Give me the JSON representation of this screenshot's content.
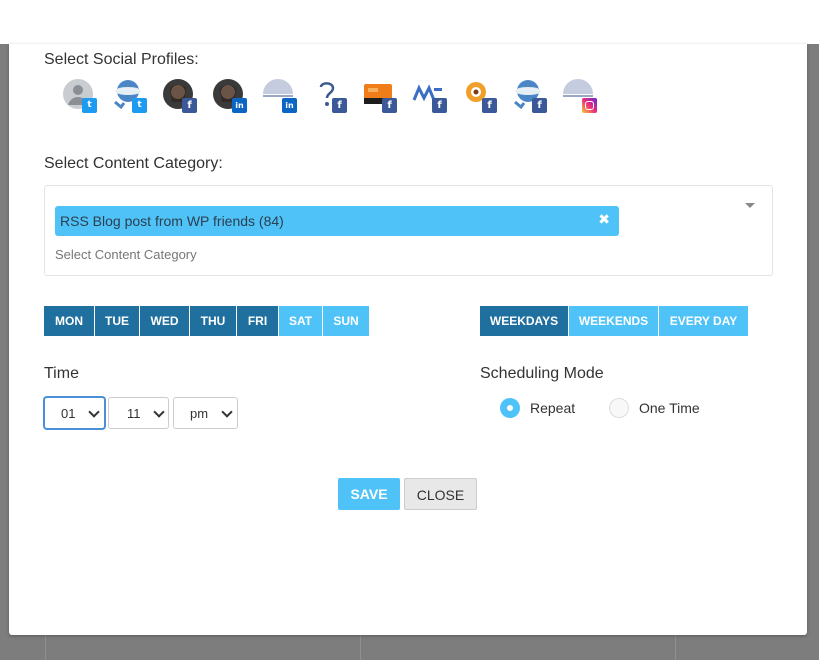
{
  "social_profiles": {
    "label": "Select Social Profiles:",
    "profiles": [
      {
        "avatar": "generic-user-icon",
        "network": "twitter"
      },
      {
        "avatar": "chat-bubble-icon",
        "network": "twitter"
      },
      {
        "avatar": "person-photo-icon",
        "network": "facebook"
      },
      {
        "avatar": "person-photo-icon",
        "network": "linkedin"
      },
      {
        "avatar": "half-circle-icon",
        "network": "linkedin"
      },
      {
        "avatar": "question-mark-icon",
        "network": "facebook"
      },
      {
        "avatar": "orange-device-icon",
        "network": "facebook"
      },
      {
        "avatar": "wp-logo-icon",
        "network": "facebook"
      },
      {
        "avatar": "ring-logo-icon",
        "network": "facebook"
      },
      {
        "avatar": "chat-bubble-icon",
        "network": "facebook"
      },
      {
        "avatar": "half-circle-icon",
        "network": "instagram"
      }
    ]
  },
  "content_category": {
    "label": "Select Content Category:",
    "selected": "RSS Blog post from WP friends (84)",
    "remove_symbol": "✖",
    "placeholder": "Select Content Category"
  },
  "days": {
    "buttons": [
      {
        "label": "MON",
        "active": true
      },
      {
        "label": "TUE",
        "active": true
      },
      {
        "label": "WED",
        "active": true
      },
      {
        "label": "THU",
        "active": true
      },
      {
        "label": "FRI",
        "active": true
      },
      {
        "label": "SAT",
        "active": false
      },
      {
        "label": "SUN",
        "active": false
      }
    ]
  },
  "presets": {
    "buttons": [
      {
        "label": "WEEKDAYS",
        "active": true
      },
      {
        "label": "WEEKENDS",
        "active": false
      },
      {
        "label": "EVERY DAY",
        "active": false
      }
    ]
  },
  "time": {
    "label": "Time",
    "hour": "01",
    "minute": "11",
    "ampm": "pm"
  },
  "scheduling_mode": {
    "label": "Scheduling Mode",
    "options": [
      {
        "label": "Repeat",
        "selected": true
      },
      {
        "label": "One Time",
        "selected": false
      }
    ]
  },
  "actions": {
    "save_label": "SAVE",
    "close_label": "CLOSE"
  },
  "colors": {
    "accent": "#4fc3f7",
    "active_day": "#1f6f9f"
  }
}
